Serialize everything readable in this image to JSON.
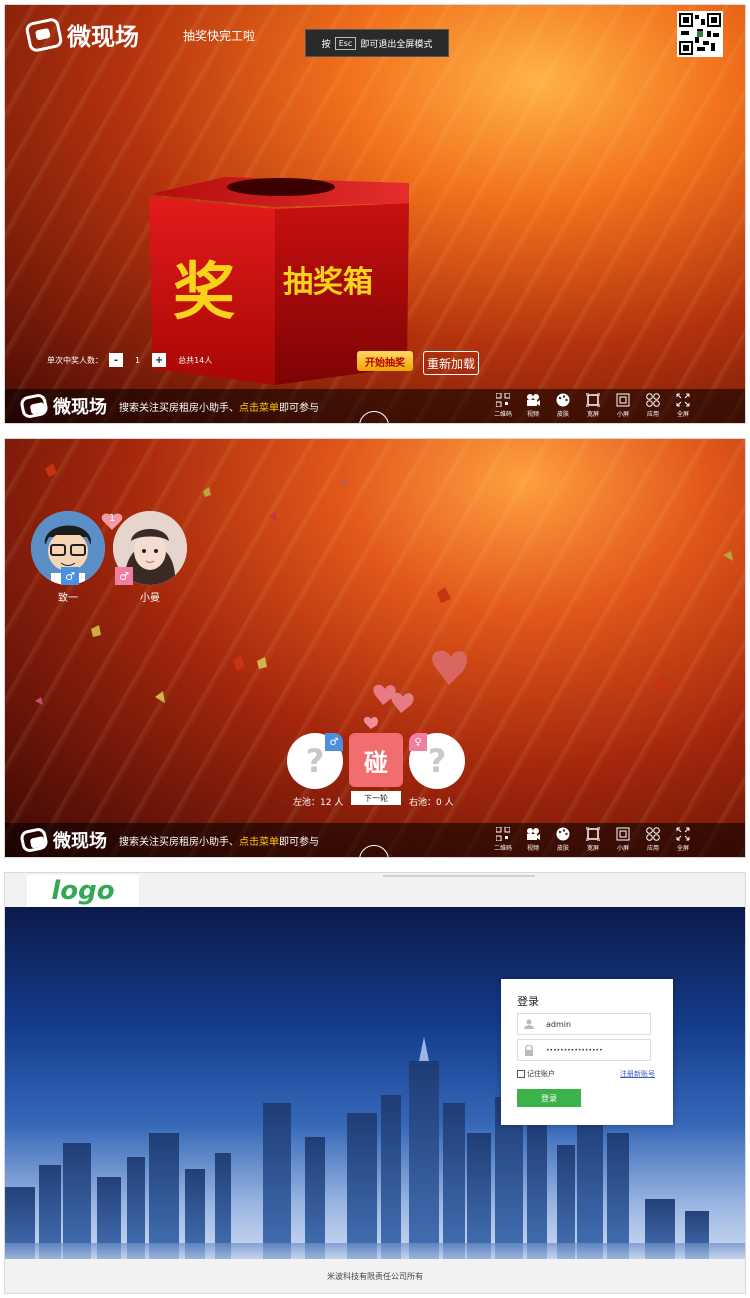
{
  "panel1": {
    "brand": "微现场",
    "top_title": "抽奖快完工啦",
    "esc_bar": {
      "prefix": "按",
      "key": "Esc",
      "suffix": "即可退出全屏模式"
    },
    "box": {
      "big_char": "奖",
      "label": "抽奖箱"
    },
    "controls": {
      "label": "单次中奖人数：",
      "minus": "-",
      "value": "1",
      "plus": "+",
      "total": "总共14人"
    },
    "start_button": "开始抽奖",
    "reload_button": "重新加载",
    "bottom": {
      "brand": "微现场",
      "slogan_prefix": "搜索关注买房租房小助手、",
      "slogan_highlight": "点击菜单",
      "slogan_suffix": "即可参与"
    },
    "tools": [
      {
        "label": "二维码",
        "icon": "qrcode-icon"
      },
      {
        "label": "视频",
        "icon": "video-icon"
      },
      {
        "label": "皮肤",
        "icon": "palette-icon"
      },
      {
        "label": "宽屏",
        "icon": "widescreen-icon"
      },
      {
        "label": "小屏",
        "icon": "smallscreen-icon"
      },
      {
        "label": "应用",
        "icon": "apps-icon"
      },
      {
        "label": "全屏",
        "icon": "fullscreen-icon"
      }
    ]
  },
  "panel2": {
    "avatars": [
      {
        "name": "致一",
        "badge": "1"
      },
      {
        "name": "小曼"
      }
    ],
    "bump_char": "碰",
    "question_mark": "?",
    "left_pool": "左池：12 人",
    "right_pool": "右池：0 人",
    "next_button": "下一轮",
    "bottom": {
      "brand": "微现场",
      "slogan_prefix": "搜索关注买房租房小助手、",
      "slogan_highlight": "点击菜单",
      "slogan_suffix": "即可参与"
    },
    "tools": [
      {
        "label": "二维码",
        "icon": "qrcode-icon"
      },
      {
        "label": "视频",
        "icon": "video-icon"
      },
      {
        "label": "皮肤",
        "icon": "palette-icon"
      },
      {
        "label": "宽屏",
        "icon": "widescreen-icon"
      },
      {
        "label": "小屏",
        "icon": "smallscreen-icon"
      },
      {
        "label": "应用",
        "icon": "apps-icon"
      },
      {
        "label": "全屏",
        "icon": "fullscreen-icon"
      }
    ]
  },
  "panel3": {
    "logo": "logo",
    "login": {
      "title": "登录",
      "username": "admin",
      "password": "••••••••••••••••",
      "remember": "记住账户",
      "register": "注册新账号",
      "submit": "登录"
    },
    "footer": "米波科技有限责任公司所有"
  },
  "colors": {
    "accent_green": "#3cb34a",
    "start_yellow": "#f0a500",
    "bump_red": "#f26d6d"
  }
}
